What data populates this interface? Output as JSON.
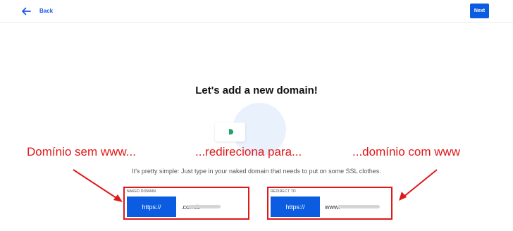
{
  "header": {
    "back_label": "Back",
    "back_icon": "arrow-left-icon",
    "next_label": "Next"
  },
  "main": {
    "title": "Let's add a new domain!",
    "subtitle": "It's pretty simple: Just type in your naked domain that needs to put on some SSL clothes."
  },
  "annotations": {
    "left": "Domínio sem www...",
    "middle": "...redireciona para...",
    "right": "...domínio com www"
  },
  "fields": {
    "naked": {
      "label": "NAKED DOMAIN",
      "protocol": "https://",
      "value": ".com.b"
    },
    "redirect": {
      "label": "REDIRECT TO",
      "protocol": "https://",
      "value": "www."
    }
  },
  "colors": {
    "primary": "#0b5ce0",
    "link": "#1a56e6",
    "annotation": "#e01818",
    "illustration_bg": "#e9f1fd",
    "illustration_glyph": "#1fa36b"
  }
}
